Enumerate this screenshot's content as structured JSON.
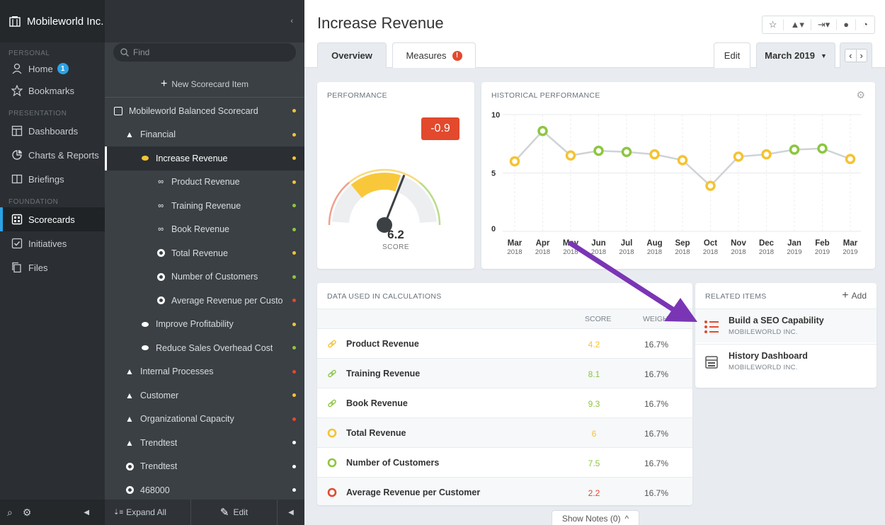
{
  "nav": {
    "org_name": "Mobileworld Inc.",
    "sections": {
      "personal": "PERSONAL",
      "presentation": "PRESENTATION",
      "foundation": "FOUNDATION"
    },
    "items": [
      {
        "label": "Home",
        "icon": "home-icon",
        "badge": "1"
      },
      {
        "label": "Bookmarks",
        "icon": "star-icon"
      },
      {
        "label": "Dashboards",
        "icon": "dashboard-icon"
      },
      {
        "label": "Charts & Reports",
        "icon": "pie-chart-icon"
      },
      {
        "label": "Briefings",
        "icon": "book-icon"
      },
      {
        "label": "Scorecards",
        "icon": "scorecard-icon",
        "active": true
      },
      {
        "label": "Initiatives",
        "icon": "checkbox-icon"
      },
      {
        "label": "Files",
        "icon": "files-icon"
      }
    ]
  },
  "tree": {
    "find_placeholder": "Find",
    "new_item": "New Scorecard Item",
    "rows": [
      {
        "label": "Mobileworld Balanced Scorecard",
        "indent": 0,
        "icon": "scorecard-icon",
        "dot": "#f5c332"
      },
      {
        "label": "Financial",
        "indent": 1,
        "icon": "triangle-icon",
        "dot": "#f5c332"
      },
      {
        "label": "Increase Revenue",
        "indent": 2,
        "icon": "oval-icon",
        "dot": "#f5c332",
        "selected": true
      },
      {
        "label": "Product Revenue",
        "indent": 3,
        "icon": "link-icon",
        "dot": "#f5c332"
      },
      {
        "label": "Training Revenue",
        "indent": 3,
        "icon": "link-icon",
        "dot": "#8dc63f"
      },
      {
        "label": "Book Revenue",
        "indent": 3,
        "icon": "link-icon",
        "dot": "#8dc63f"
      },
      {
        "label": "Total Revenue",
        "indent": 3,
        "icon": "measure-icon",
        "dot": "#f5c332"
      },
      {
        "label": "Number of Customers",
        "indent": 3,
        "icon": "measure-icon",
        "dot": "#8dc63f"
      },
      {
        "label": "Average Revenue per Custo",
        "indent": 3,
        "icon": "measure-icon",
        "dot": "#e2492d"
      },
      {
        "label": "Improve Profitability",
        "indent": 2,
        "icon": "oval-icon",
        "dot": "#f5c332"
      },
      {
        "label": "Reduce Sales Overhead Cost",
        "indent": 2,
        "icon": "oval-icon",
        "dot": "#8dc63f"
      },
      {
        "label": "Internal Processes",
        "indent": 1,
        "icon": "triangle-icon",
        "dot": "#e2492d"
      },
      {
        "label": "Customer",
        "indent": 1,
        "icon": "triangle-icon",
        "dot": "#f5c332"
      },
      {
        "label": "Organizational Capacity",
        "indent": 1,
        "icon": "triangle-icon",
        "dot": "#e2492d"
      },
      {
        "label": "Trendtest",
        "indent": 1,
        "icon": "triangle-icon",
        "dot": "#ffffff"
      },
      {
        "label": "Trendtest",
        "indent": 1,
        "icon": "measure-icon",
        "dot": "#ffffff"
      },
      {
        "label": "468000",
        "indent": 1,
        "icon": "measure-icon",
        "dot": "#ffffff"
      }
    ],
    "expand_all": "Expand All",
    "edit": "Edit"
  },
  "header": {
    "title": "Increase Revenue",
    "tabs": [
      {
        "label": "Overview",
        "active": true
      },
      {
        "label": "Measures",
        "warn": "!"
      }
    ],
    "edit": "Edit",
    "period": "March 2019"
  },
  "performance": {
    "title": "PERFORMANCE",
    "change": "-0.9",
    "score": "6.2",
    "score_label": "SCORE",
    "gauge_value": 6.2,
    "gauge_max": 10
  },
  "history": {
    "title": "HISTORICAL PERFORMANCE"
  },
  "chart_data": {
    "type": "line",
    "categories": [
      "Mar 2018",
      "Apr 2018",
      "May 2018",
      "Jun 2018",
      "Jul 2018",
      "Aug 2018",
      "Sep 2018",
      "Oct 2018",
      "Nov 2018",
      "Dec 2018",
      "Jan 2019",
      "Feb 2019",
      "Mar 2019"
    ],
    "tick_month": [
      "Mar",
      "Apr",
      "May",
      "Jun",
      "Jul",
      "Aug",
      "Sep",
      "Oct",
      "Nov",
      "Dec",
      "Jan",
      "Feb",
      "Mar"
    ],
    "tick_year": [
      "2018",
      "2018",
      "2018",
      "2018",
      "2018",
      "2018",
      "2018",
      "2018",
      "2018",
      "2018",
      "2019",
      "2019",
      "2019"
    ],
    "values": [
      6.0,
      8.6,
      6.5,
      6.9,
      6.8,
      6.6,
      6.1,
      3.9,
      6.4,
      6.6,
      7.0,
      7.1,
      6.2
    ],
    "point_colors": [
      "#f5c332",
      "#8dc63f",
      "#f5c332",
      "#8dc63f",
      "#8dc63f",
      "#f5c332",
      "#f5c332",
      "#f5c332",
      "#f5c332",
      "#f5c332",
      "#8dc63f",
      "#8dc63f",
      "#f5c332"
    ],
    "yticks": [
      "0",
      "5",
      "10"
    ],
    "ylim": [
      0,
      10
    ],
    "grid": true
  },
  "calc": {
    "title": "DATA USED IN CALCULATIONS",
    "col_score": "SCORE",
    "col_weight": "WEIGHT",
    "rows": [
      {
        "name": "Product Revenue",
        "score": "4.2",
        "weight": "16.7%",
        "color": "#f5c332",
        "icon": "link"
      },
      {
        "name": "Training Revenue",
        "score": "8.1",
        "weight": "16.7%",
        "color": "#8dc63f",
        "icon": "link"
      },
      {
        "name": "Book Revenue",
        "score": "9.3",
        "weight": "16.7%",
        "color": "#8dc63f",
        "icon": "link"
      },
      {
        "name": "Total Revenue",
        "score": "6",
        "weight": "16.7%",
        "color": "#f5c332",
        "icon": "measure"
      },
      {
        "name": "Number of Customers",
        "score": "7.5",
        "weight": "16.7%",
        "color": "#8dc63f",
        "icon": "measure"
      },
      {
        "name": "Average Revenue per Customer",
        "score": "2.2",
        "weight": "16.7%",
        "color": "#e2492d",
        "icon": "measure"
      }
    ]
  },
  "related": {
    "title": "RELATED ITEMS",
    "add": "Add",
    "items": [
      {
        "title": "Build a SEO Capability",
        "sub": "MOBILEWORLD INC.",
        "icon": "initiative-list-icon"
      },
      {
        "title": "History Dashboard",
        "sub": "MOBILEWORLD INC.",
        "icon": "dashboard-icon"
      }
    ]
  },
  "show_notes": "Show Notes (0)",
  "colors": {
    "accent": "#2aa3e6",
    "red": "#e2492d",
    "yellow": "#f5c332",
    "green": "#8dc63f",
    "arrow": "#7a35b5"
  }
}
